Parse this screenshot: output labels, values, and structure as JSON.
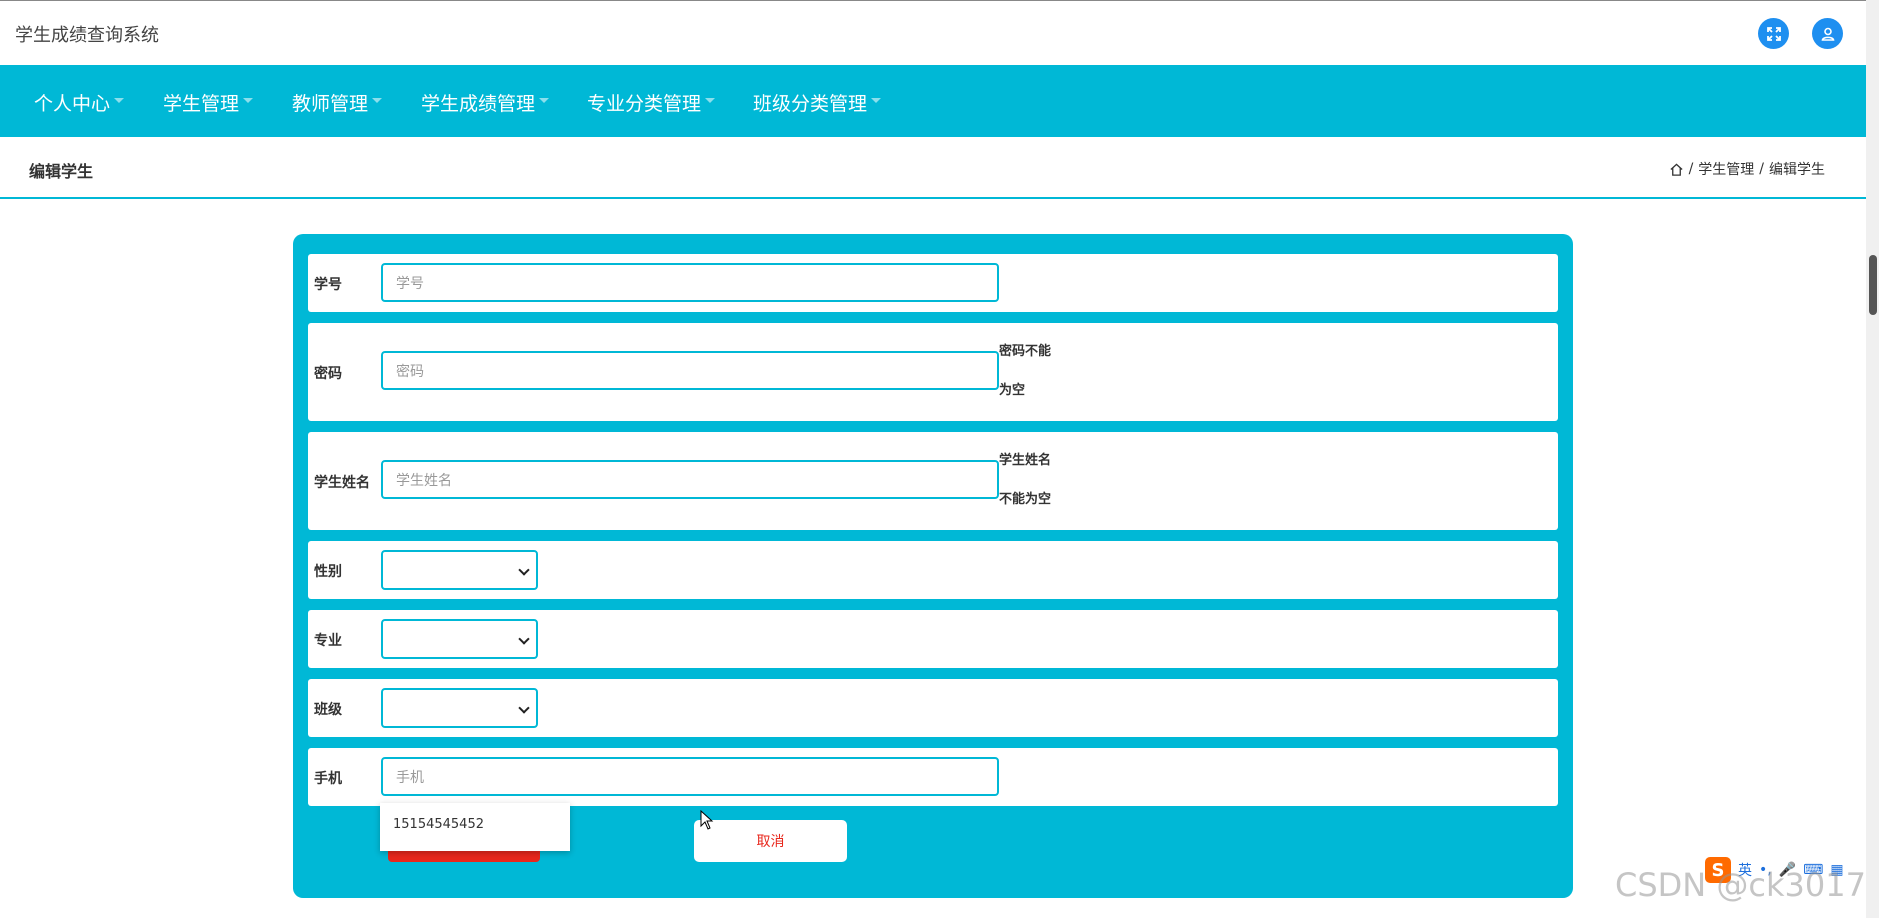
{
  "header": {
    "title": "学生成绩查询系统"
  },
  "nav": {
    "items": [
      {
        "label": "个人中心"
      },
      {
        "label": "学生管理"
      },
      {
        "label": "教师管理"
      },
      {
        "label": "学生成绩管理"
      },
      {
        "label": "专业分类管理"
      },
      {
        "label": "班级分类管理"
      }
    ]
  },
  "page": {
    "title": "编辑学生",
    "breadcrumb": {
      "section": "学生管理",
      "current": "编辑学生",
      "separator": "/"
    }
  },
  "form": {
    "student_id": {
      "label": "学号",
      "placeholder": "学号",
      "value": ""
    },
    "password": {
      "label": "密码",
      "placeholder": "密码",
      "value": "",
      "error_line1": "密码不能",
      "error_line2": "为空"
    },
    "name": {
      "label": "学生姓名",
      "placeholder": "学生姓名",
      "value": "",
      "error_line1": "学生姓名",
      "error_line2": "不能为空"
    },
    "gender": {
      "label": "性别",
      "selected": ""
    },
    "major": {
      "label": "专业",
      "selected": ""
    },
    "class": {
      "label": "班级",
      "selected": ""
    },
    "phone": {
      "label": "手机",
      "placeholder": "手机",
      "value": "",
      "suggestion": "15154545452"
    },
    "cancel_label": "取消",
    "submit_label": ""
  },
  "ime": {
    "mode": "英"
  },
  "watermark": "CSDN @ck3017",
  "colors": {
    "accent": "#00b8d6",
    "primary_blue": "#1e8ff0",
    "danger": "#e8271c"
  },
  "icons": {
    "fullscreen": "fullscreen-icon",
    "user": "user-icon",
    "home": "home-icon"
  }
}
